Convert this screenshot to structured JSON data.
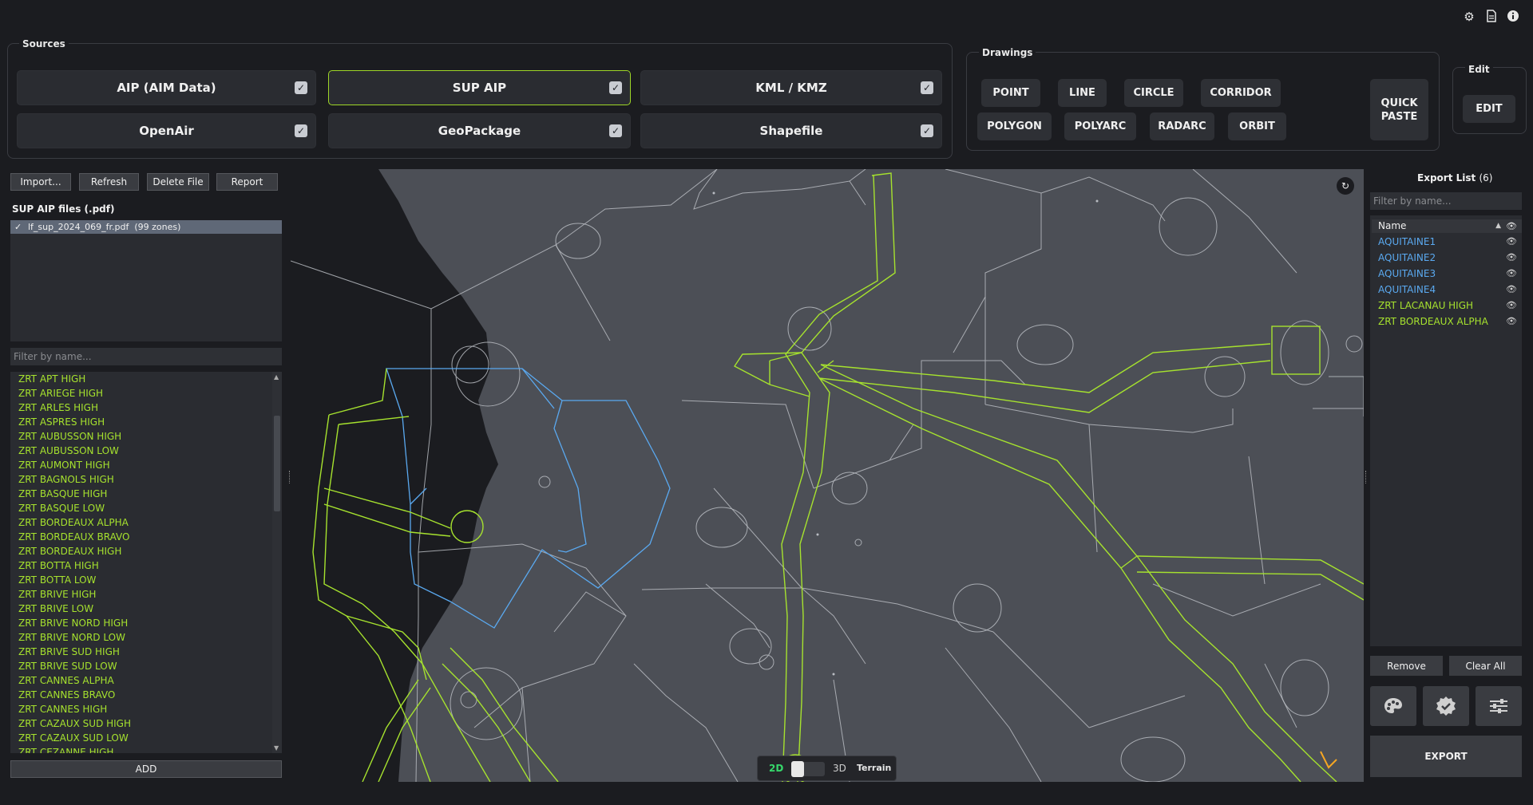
{
  "top_icons": [
    "gear-icon",
    "document-icon",
    "info-icon"
  ],
  "sources": {
    "title": "Sources",
    "buttons": [
      {
        "label": "AIP (AIM Data)",
        "checked": true
      },
      {
        "label": "SUP AIP",
        "checked": true,
        "active": true
      },
      {
        "label": "KML / KMZ",
        "checked": true
      },
      {
        "label": "OpenAir",
        "checked": true
      },
      {
        "label": "GeoPackage",
        "checked": true
      },
      {
        "label": "Shapefile",
        "checked": true
      }
    ]
  },
  "drawings": {
    "title": "Drawings",
    "buttons": [
      "POINT",
      "LINE",
      "CIRCLE",
      "CORRIDOR",
      "POLYGON",
      "POLYARC",
      "RADARC",
      "ORBIT"
    ],
    "quick_paste": "QUICK PASTE"
  },
  "edit": {
    "title": "Edit",
    "button": "EDIT"
  },
  "file_actions": {
    "import": "Import...",
    "refresh": "Refresh",
    "delete": "Delete File",
    "report": "Report"
  },
  "files": {
    "title": "SUP AIP files (.pdf)",
    "items": [
      {
        "name": "lf_sup_2024_069_fr.pdf",
        "zones": "(99 zones)"
      }
    ]
  },
  "zone_filter_placeholder": "Filter by name...",
  "zones": [
    "ZRT APT HIGH",
    "ZRT ARIEGE HIGH",
    "ZRT ARLES HIGH",
    "ZRT ASPRES HIGH",
    "ZRT AUBUSSON HIGH",
    "ZRT AUBUSSON LOW",
    "ZRT AUMONT HIGH",
    "ZRT BAGNOLS HIGH",
    "ZRT BASQUE HIGH",
    "ZRT BASQUE LOW",
    "ZRT BORDEAUX ALPHA",
    "ZRT BORDEAUX BRAVO",
    "ZRT BORDEAUX HIGH",
    "ZRT BOTTA HIGH",
    "ZRT BOTTA LOW",
    "ZRT BRIVE HIGH",
    "ZRT BRIVE LOW",
    "ZRT BRIVE NORD HIGH",
    "ZRT BRIVE NORD LOW",
    "ZRT BRIVE SUD HIGH",
    "ZRT BRIVE SUD LOW",
    "ZRT CANNES ALPHA",
    "ZRT CANNES BRAVO",
    "ZRT CANNES HIGH",
    "ZRT CAZAUX SUD HIGH",
    "ZRT CAZAUX SUD LOW",
    "ZRT CEZANNE HIGH"
  ],
  "add_button": "ADD",
  "map": {
    "toggle_2d": "2D",
    "toggle_3d": "3D",
    "terrain": "Terrain"
  },
  "export": {
    "title": "Export List",
    "count": "(6)",
    "filter_placeholder": "Filter by name...",
    "column": "Name",
    "items": [
      {
        "name": "AQUITAINE1",
        "color": "#5aa9f0"
      },
      {
        "name": "AQUITAINE2",
        "color": "#5aa9f0"
      },
      {
        "name": "AQUITAINE3",
        "color": "#5aa9f0"
      },
      {
        "name": "AQUITAINE4",
        "color": "#5aa9f0"
      },
      {
        "name": "ZRT LACANAU HIGH",
        "color": "#a6e22e"
      },
      {
        "name": "ZRT BORDEAUX ALPHA",
        "color": "#a6e22e"
      }
    ],
    "remove": "Remove",
    "clear_all": "Clear All",
    "export_button": "EXPORT",
    "tool_icons": [
      "palette-icon",
      "check-badge-icon",
      "sliders-icon"
    ]
  },
  "colors": {
    "accent_green": "#a6e22e",
    "accent_blue": "#5aa9f0",
    "background": "#1b1c20",
    "map": "#4c4f56"
  }
}
